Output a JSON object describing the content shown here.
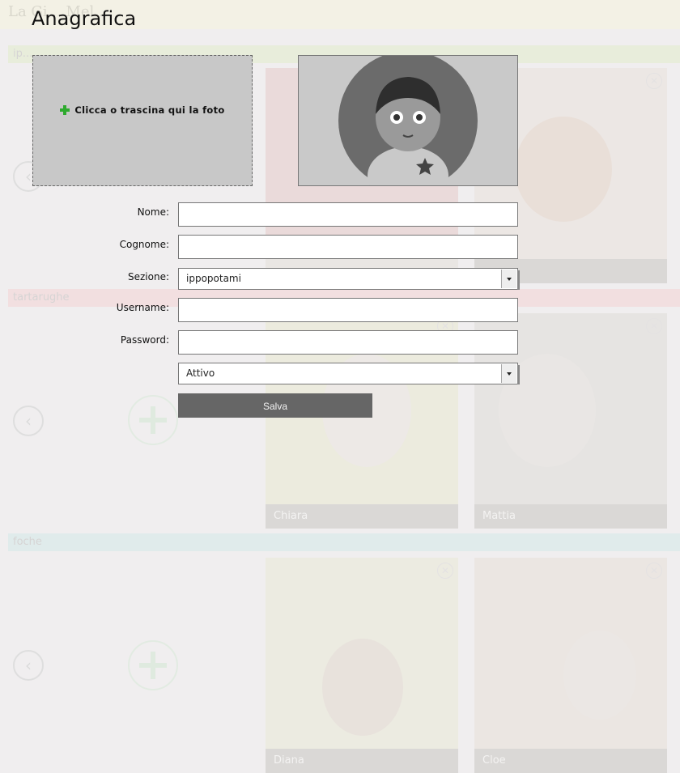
{
  "background": {
    "brand": "La Gi... Mel...",
    "sections": [
      {
        "name": "ip..."
      },
      {
        "name": "tartarughe"
      },
      {
        "name": "foche"
      }
    ],
    "arrow_glyph": "‹",
    "cards": {
      "chiara": "Chiara",
      "mattia": "Mattia",
      "diana": "Diana",
      "cloe": "Cloe"
    }
  },
  "modal": {
    "title": "Anagrafica",
    "dropzone_label": "Clicca o trascina qui la foto",
    "avatar_icon": "child-avatar-icon",
    "form": {
      "nome_label": "Nome:",
      "nome_value": "",
      "cognome_label": "Cognome:",
      "cognome_value": "",
      "sezione_label": "Sezione:",
      "sezione_value": "ippopotami",
      "username_label": "Username:",
      "username_value": "",
      "password_label": "Password:",
      "password_value": "",
      "status_value": "Attivo",
      "save_label": "Salva"
    }
  },
  "colors": {
    "plus_green": "#2eaa2e",
    "button_gray": "#666666"
  }
}
